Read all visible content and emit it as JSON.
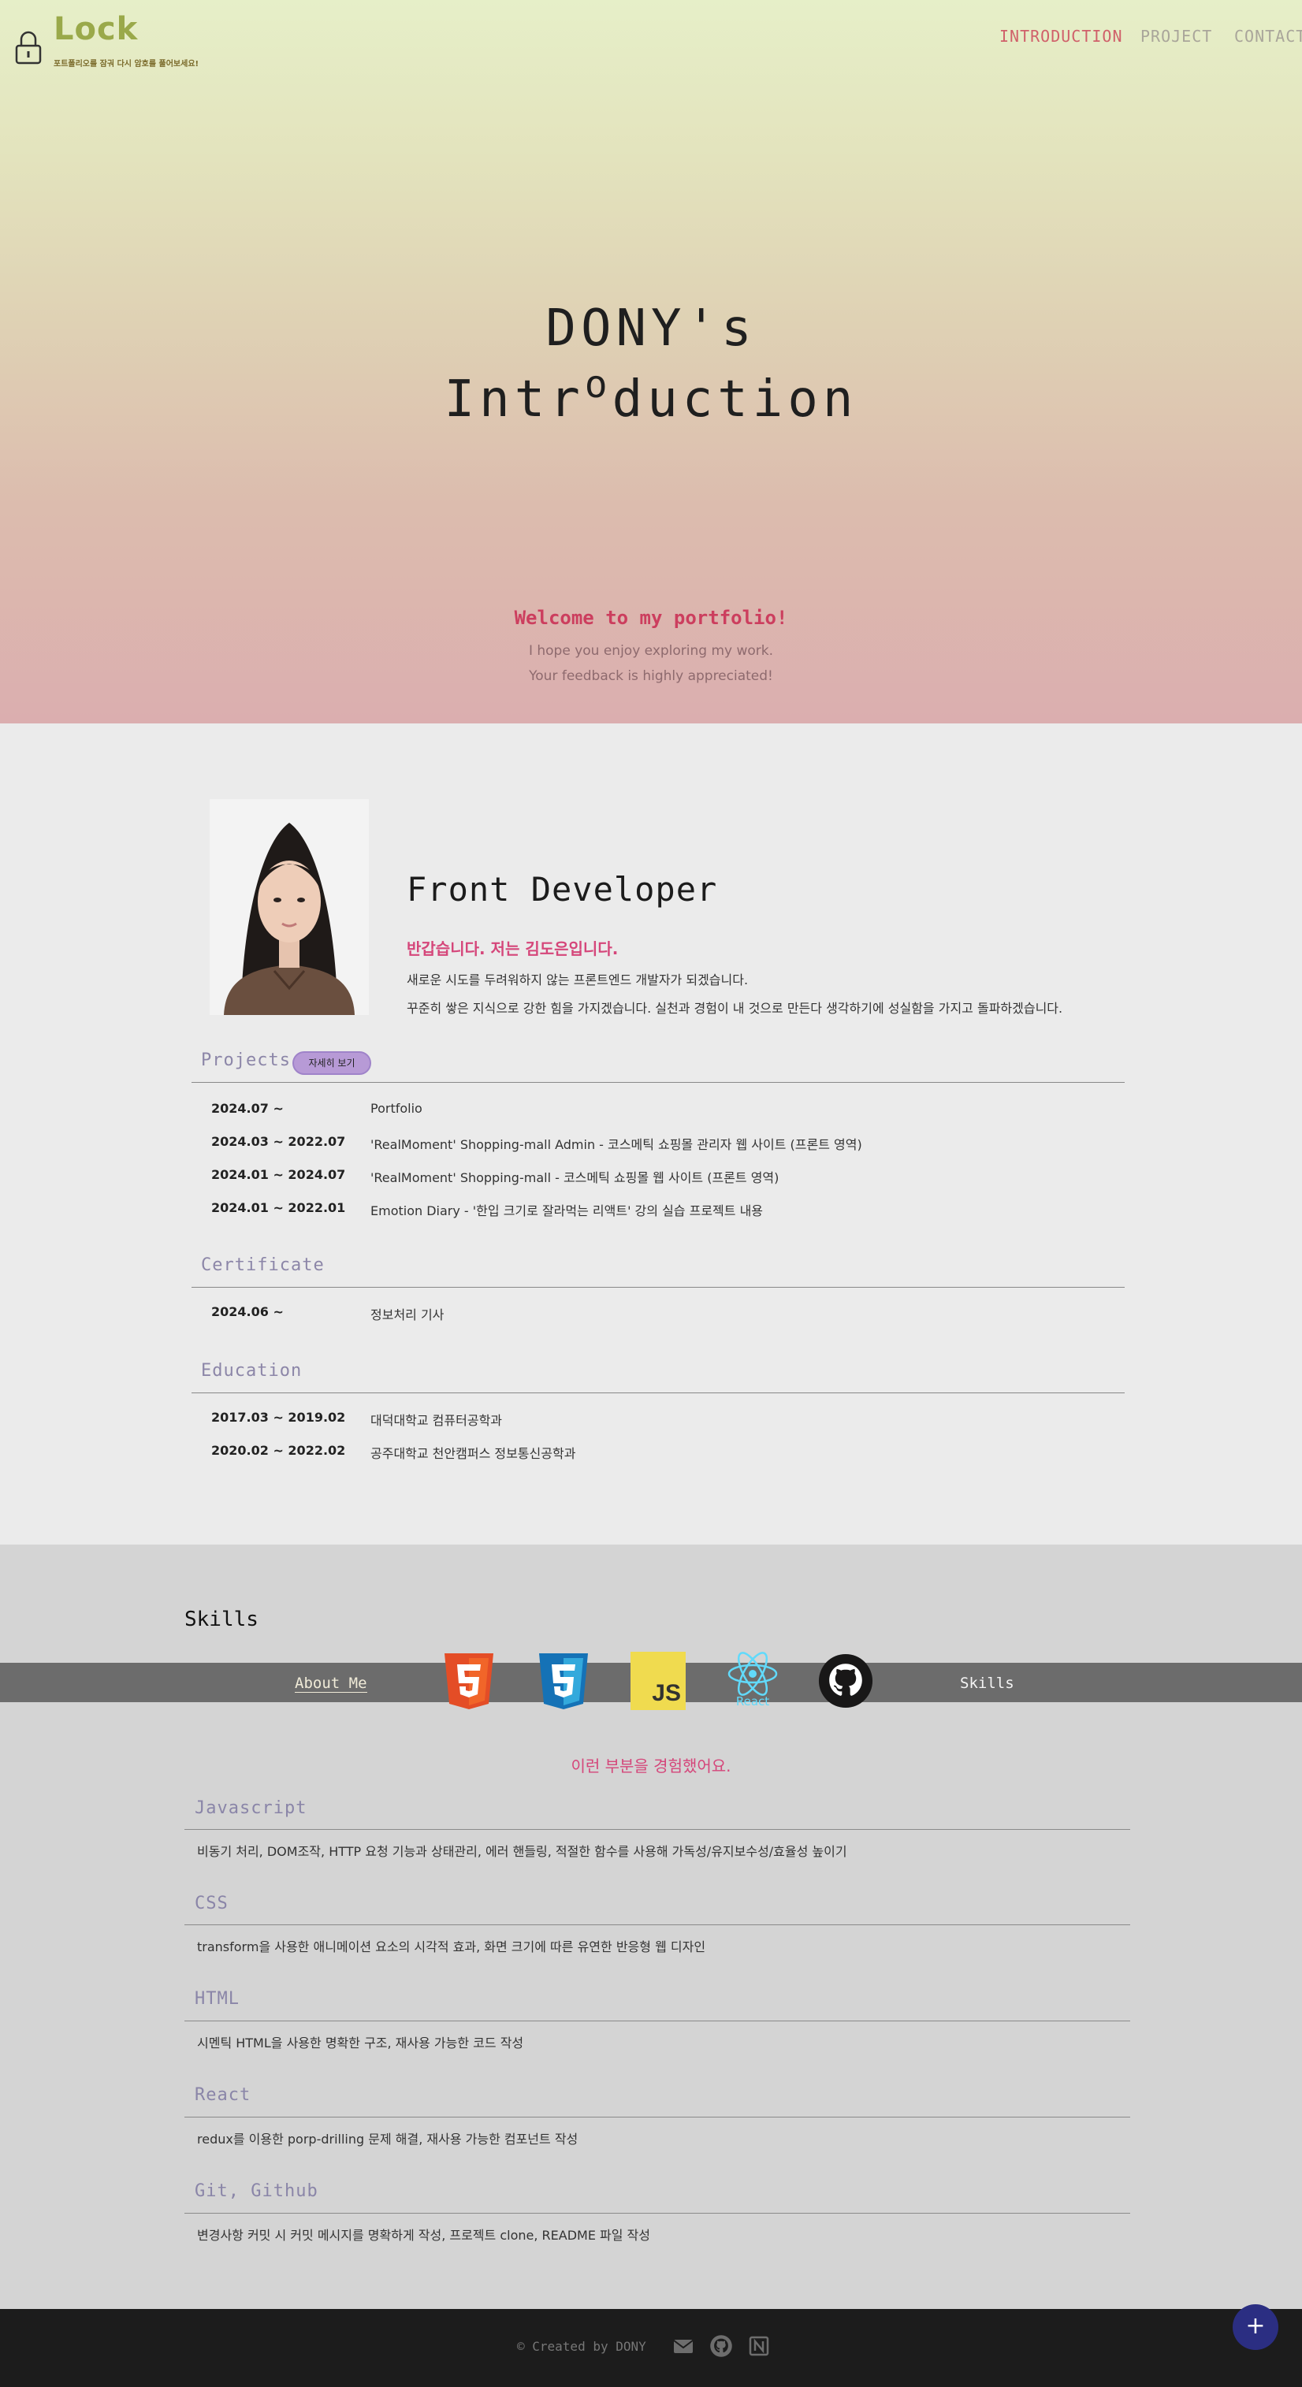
{
  "header": {
    "logo_title": "Lock",
    "logo_subtitle": "포트폴리오를 잠궈 다시 암호를 풀어보세요!",
    "nav": [
      "INTRODUCTION",
      "PROJECT",
      "CONTACT"
    ],
    "active_nav": "INTRODUCTION"
  },
  "hero": {
    "title_line1": "DONY's",
    "title_line2_prefix": "Intr",
    "title_line2_raised": "o",
    "title_line2_suffix": "duction",
    "welcome": "Welcome to my portfolio!",
    "sub_line1": "I hope you enjoy exploring my work.",
    "sub_line2": "Your feedback is highly appreciated!"
  },
  "about": {
    "role": "Front Developer",
    "greeting": "반갑습니다.  저는  김도은입니다.",
    "intro_line1": "새로운 시도를 두려워하지 않는 프론트엔드 개발자가 되겠습니다.",
    "intro_line2": "꾸준히 쌓은 지식으로 강한 힘을 가지겠습니다. 실천과 경험이 내 것으로 만든다 생각하기에 성실함을 가지고 돌파하겠습니다.",
    "projects": {
      "heading": "Projects",
      "more_button": "자세히 보기",
      "rows": [
        {
          "date": "2024.07 ~",
          "desc": "Portfolio"
        },
        {
          "date": "2024.03 ~ 2022.07",
          "desc": "'RealMoment' Shopping-mall Admin - 코스메틱 쇼핑몰 관리자 웹 사이트 (프론트 영역)"
        },
        {
          "date": "2024.01 ~ 2024.07",
          "desc": "'RealMoment' Shopping-mall - 코스메틱 쇼핑몰 웹 사이트 (프론트 영역)"
        },
        {
          "date": "2024.01 ~ 2022.01",
          "desc": "Emotion Diary - '한입 크기로 잘라먹는 리액트' 강의 실습 프로젝트 내용"
        }
      ]
    },
    "certificate": {
      "heading": "Certificate",
      "rows": [
        {
          "date": "2024.06 ~",
          "desc": "정보처리 기사"
        }
      ]
    },
    "education": {
      "heading": "Education",
      "rows": [
        {
          "date": "2017.03 ~ 2019.02",
          "desc": "대덕대학교 컴퓨터공학과"
        },
        {
          "date": "2020.02 ~ 2022.02",
          "desc": "공주대학교 천안캠퍼스 정보통신공학과"
        }
      ]
    }
  },
  "skills": {
    "title": "Skills",
    "tab_about": "About Me",
    "tab_skills": "Skills",
    "icons": [
      "html5-icon",
      "css3-icon",
      "javascript-icon",
      "react-icon",
      "github-icon"
    ],
    "js_label": "JS",
    "react_label": "React",
    "subtitle": "이런  부분을  경험했어요.",
    "items": [
      {
        "name": "Javascript",
        "desc": "비동기 처리, DOM조작, HTTP 요청 기능과 상태관리, 에러 핸들링, 적절한 함수를 사용해 가독성/유지보수성/효율성 높이기"
      },
      {
        "name": "CSS",
        "desc": "transform을 사용한 애니메이션 요소의 시각적 효과, 화면 크기에 따른 유연한 반응형 웹 디자인"
      },
      {
        "name": "HTML",
        "desc": "시멘틱 HTML을 사용한 명확한 구조, 재사용 가능한 코드 작성"
      },
      {
        "name": "React",
        "desc": "redux를 이용한 porp-drilling 문제 해결, 재사용 가능한 컴포넌트 작성"
      },
      {
        "name": "Git, Github",
        "desc": "변경사항 커밋 시 커밋 메시지를 명확하게 작성, 프로젝트 clone, README 파일 작성"
      }
    ]
  },
  "footer": {
    "copyright": "© Created by DONY",
    "icons": [
      "mail-icon",
      "github-icon",
      "notion-icon"
    ]
  },
  "fab": {
    "label": "+"
  },
  "colors": {
    "accent_pink": "#d5467a",
    "nav_active": "#d0606a",
    "logo": "#9aa94a",
    "fab": "#2b2e82"
  }
}
